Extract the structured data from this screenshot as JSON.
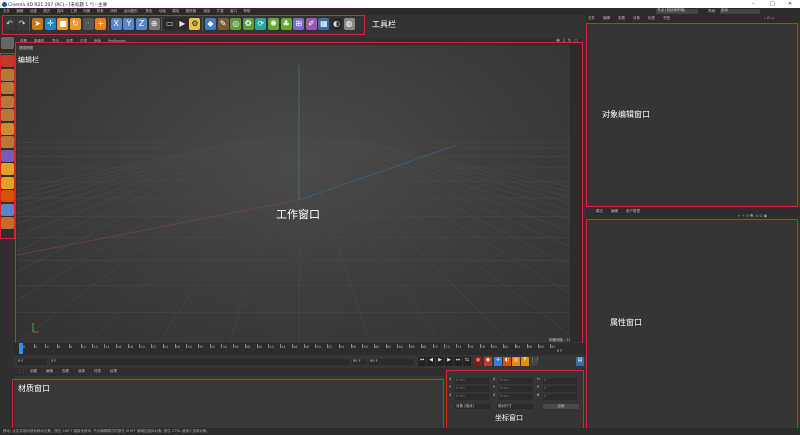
{
  "window": {
    "title": "Cinema 4D R21.207 (RC) - [未标题 1 *] - 主要",
    "controls": [
      "–",
      "□",
      "✕"
    ]
  },
  "menu": {
    "items": [
      "文件",
      "编辑",
      "创建",
      "模式",
      "选择",
      "工具",
      "网格",
      "样条",
      "体积",
      "运动图形",
      "角色",
      "动画",
      "模拟",
      "跟踪器",
      "渲染",
      "扩展",
      "窗口",
      "帮助"
    ],
    "right": {
      "interface_label": "界面:",
      "interface_value": "启动",
      "node_value": "节点 (包括体积轴)"
    }
  },
  "toolbar": {
    "annotation": "工具栏",
    "buttons": [
      {
        "name": "undo",
        "glyph": "↶",
        "bg": "#3a3a3a",
        "fg": "#ddd"
      },
      {
        "name": "redo",
        "glyph": "↷",
        "bg": "#3a3a3a",
        "fg": "#ddd"
      },
      {
        "name": "select",
        "glyph": "➤",
        "bg": "#c17a1e",
        "fg": "#fff"
      },
      {
        "name": "move",
        "glyph": "✛",
        "bg": "#1f86c9",
        "fg": "#fff"
      },
      {
        "name": "scale",
        "glyph": "■",
        "bg": "#f0932b",
        "fg": "#fff"
      },
      {
        "name": "rotate",
        "glyph": "↻",
        "bg": "#f0932b",
        "fg": "#fff"
      },
      {
        "name": "recent",
        "glyph": "·",
        "bg": "#555",
        "fg": "#ddd"
      },
      {
        "name": "create",
        "glyph": "+",
        "bg": "#e67e22",
        "fg": "#fff"
      },
      {
        "name": "x-axis",
        "glyph": "X",
        "bg": "#5a86c9",
        "fg": "#fff"
      },
      {
        "name": "y-axis",
        "glyph": "Y",
        "bg": "#5a86c9",
        "fg": "#fff"
      },
      {
        "name": "z-axis",
        "glyph": "Z",
        "bg": "#5a86c9",
        "fg": "#fff"
      },
      {
        "name": "coord-system",
        "glyph": "⊕",
        "bg": "#777",
        "fg": "#fff"
      },
      {
        "name": "render-view",
        "glyph": "▭",
        "bg": "#2a2a2a",
        "fg": "#ddd"
      },
      {
        "name": "render-picture",
        "glyph": "▶",
        "bg": "#2a2a2a",
        "fg": "#ddd"
      },
      {
        "name": "render-settings",
        "glyph": "⚙",
        "bg": "#e8c545",
        "fg": "#222"
      },
      {
        "name": "cube",
        "glyph": "◆",
        "bg": "#3b7ec2",
        "fg": "#fff"
      },
      {
        "name": "pen",
        "glyph": "✎",
        "bg": "#7a5a3a",
        "fg": "#fff"
      },
      {
        "name": "subdivision",
        "glyph": "◎",
        "bg": "#5b9b3a",
        "fg": "#fff"
      },
      {
        "name": "array",
        "glyph": "❂",
        "bg": "#5b9b3a",
        "fg": "#fff"
      },
      {
        "name": "deformer",
        "glyph": "⟳",
        "bg": "#2ea4a0",
        "fg": "#fff"
      },
      {
        "name": "field",
        "glyph": "✺",
        "bg": "#67a832",
        "fg": "#fff"
      },
      {
        "name": "scene",
        "glyph": "♣",
        "bg": "#67a832",
        "fg": "#fff"
      },
      {
        "name": "camera",
        "glyph": "⊞",
        "bg": "#7c6bc9",
        "fg": "#fff"
      },
      {
        "name": "light",
        "glyph": "✐",
        "bg": "#9b59b6",
        "fg": "#fff"
      },
      {
        "name": "grid-tool",
        "glyph": "▦",
        "bg": "#3a6ea5",
        "fg": "#fff"
      },
      {
        "name": "picture-viewer",
        "glyph": "◐",
        "bg": "#2a2a2a",
        "fg": "#ddd"
      },
      {
        "name": "extra",
        "glyph": "◍",
        "bg": "#888",
        "fg": "#fff"
      }
    ]
  },
  "left_column": {
    "annotation": "编辑栏",
    "buttons": [
      {
        "name": "make-editable",
        "bg": "#666"
      },
      {
        "name": "model-mode",
        "bg": "#c0392b"
      },
      {
        "name": "texture-mode",
        "bg": "#b9773a"
      },
      {
        "name": "points-mode",
        "bg": "#b9773a"
      },
      {
        "name": "edges-mode",
        "bg": "#b9773a"
      },
      {
        "name": "polygons-mode",
        "bg": "#b9773a"
      },
      {
        "name": "axis-mode",
        "bg": "#d18b2f"
      },
      {
        "name": "solo",
        "bg": "#b9773a"
      },
      {
        "name": "snap",
        "bg": "#7d5ab5"
      },
      {
        "name": "workplane",
        "bg": "#e5a023"
      },
      {
        "name": "lock-workplane",
        "bg": "#e5a023"
      },
      {
        "name": "guide",
        "bg": "#d35400"
      },
      {
        "name": "ortho",
        "bg": "#5a86c9"
      },
      {
        "name": "planar",
        "bg": "#c86b2a"
      }
    ]
  },
  "viewport": {
    "annotation": "工作窗口",
    "menu": [
      "查看",
      "摄像机",
      "显示",
      "选项",
      "过滤",
      "面板",
      "ProRender"
    ],
    "title": "透视视图",
    "camera": "默认摄像机 ✱",
    "grid_spacing": "网格间距 : 100 cm"
  },
  "timeline": {
    "ticks": [
      "0",
      "2",
      "4",
      "6",
      "8",
      "10",
      "12",
      "14",
      "16",
      "18",
      "20",
      "22",
      "24",
      "26",
      "28",
      "30",
      "32",
      "34",
      "36",
      "38",
      "40",
      "42",
      "44",
      "46",
      "48",
      "50",
      "52",
      "54",
      "56",
      "58",
      "60",
      "62",
      "64",
      "66",
      "68",
      "70",
      "72",
      "74",
      "76",
      "78",
      "80",
      "82",
      "84",
      "86",
      "88",
      "90"
    ],
    "end_label": "0 F"
  },
  "playbar": {
    "current_frame": "0 F",
    "start_frame": "0 F",
    "end_frame": "90 F",
    "end_frame2": "90 F"
  },
  "material": {
    "annotation": "材质窗口",
    "menu": [
      "创建",
      "编辑",
      "查看",
      "选择",
      "材质",
      "纹理"
    ]
  },
  "coordinates": {
    "annotation": "坐标窗口",
    "rows": [
      {
        "axis": "X",
        "pos": "0 cm",
        "axis2": "X",
        "size": "0 cm",
        "axis3": "H",
        "rot": "0 °"
      },
      {
        "axis": "Y",
        "pos": "0 cm",
        "axis2": "Y",
        "size": "0 cm",
        "axis3": "P",
        "rot": "0 °"
      },
      {
        "axis": "Z",
        "pos": "0 cm",
        "axis2": "Z",
        "size": "0 cm",
        "axis3": "B",
        "rot": "0 °"
      }
    ],
    "mode": "对象 (相对)",
    "size_mode": "绝对尺寸",
    "apply": "应用"
  },
  "object_manager": {
    "annotation": "对象编辑窗口",
    "menu": [
      "文件",
      "编辑",
      "查看",
      "对象",
      "标签",
      "书签"
    ]
  },
  "attribute_manager": {
    "annotation": "属性窗口",
    "menu": [
      "模式",
      "编辑",
      "用户数据"
    ]
  },
  "status": {
    "text": "移动: 点击并拖动鼠标移动元素。按住 SHIFT 键量化移动; 节点编辑模式时按住 SHIFT 键增加选择对象; 按住 CTRL 键减少选择对象。"
  }
}
